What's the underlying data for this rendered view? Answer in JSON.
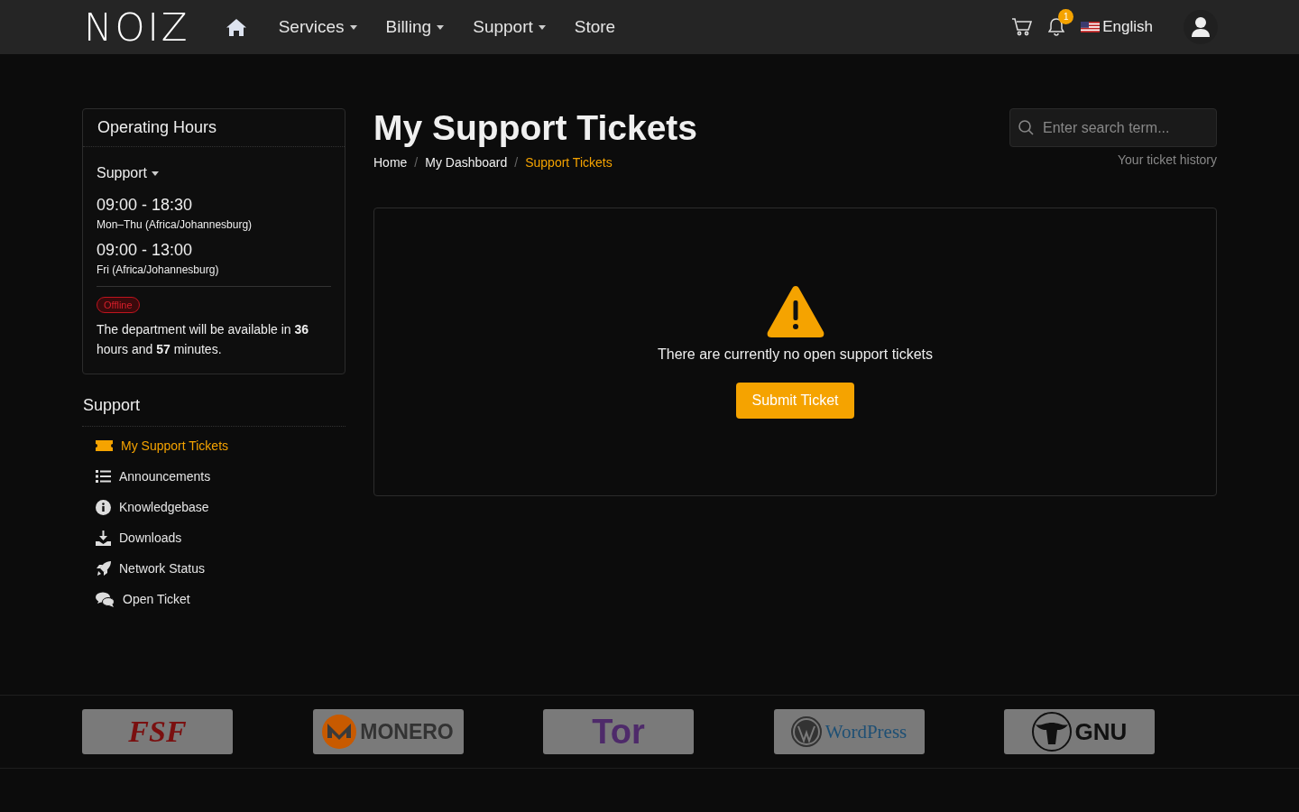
{
  "navbar": {
    "logo": "NOIZ",
    "items": [
      {
        "label": "Services",
        "dropdown": true
      },
      {
        "label": "Billing",
        "dropdown": true
      },
      {
        "label": "Support",
        "dropdown": true
      },
      {
        "label": "Store",
        "dropdown": false
      }
    ],
    "notification_count": "1",
    "language": "English"
  },
  "operating_hours": {
    "title": "Operating Hours",
    "department": "Support",
    "schedules": [
      {
        "time": "09:00 - 18:30",
        "days": "Mon–Thu (Africa/Johannesburg)"
      },
      {
        "time": "09:00 - 13:00",
        "days": "Fri (Africa/Johannesburg)"
      }
    ],
    "status": "Offline",
    "message": "The department will be available in **36** hours and **57** minutes."
  },
  "support_menu": {
    "title": "Support",
    "items": [
      {
        "label": "My Support Tickets",
        "selected": true
      },
      {
        "label": "Announcements",
        "selected": false
      },
      {
        "label": "Knowledgebase",
        "selected": false
      },
      {
        "label": "Downloads",
        "selected": false
      },
      {
        "label": "Network Status",
        "selected": false
      },
      {
        "label": "Open Ticket",
        "selected": false
      }
    ]
  },
  "page": {
    "title": "My Support Tickets",
    "breadcrumb_separator": "/",
    "breadcrumb": [
      {
        "label": "Home",
        "selected": false
      },
      {
        "label": "My Dashboard",
        "selected": false
      },
      {
        "label": "Support Tickets",
        "selected": true
      }
    ],
    "search": {
      "placeholder": "Enter search term..."
    },
    "history_link": "Your ticket history",
    "empty_message": "There are currently no open support tickets",
    "submit_button": "Submit Ticket"
  },
  "footer_logos": [
    {
      "text": "FSF"
    },
    {
      "text": "MONERO"
    },
    {
      "text": "Tor"
    },
    {
      "text": "WordPress"
    },
    {
      "text": "GNU"
    }
  ]
}
